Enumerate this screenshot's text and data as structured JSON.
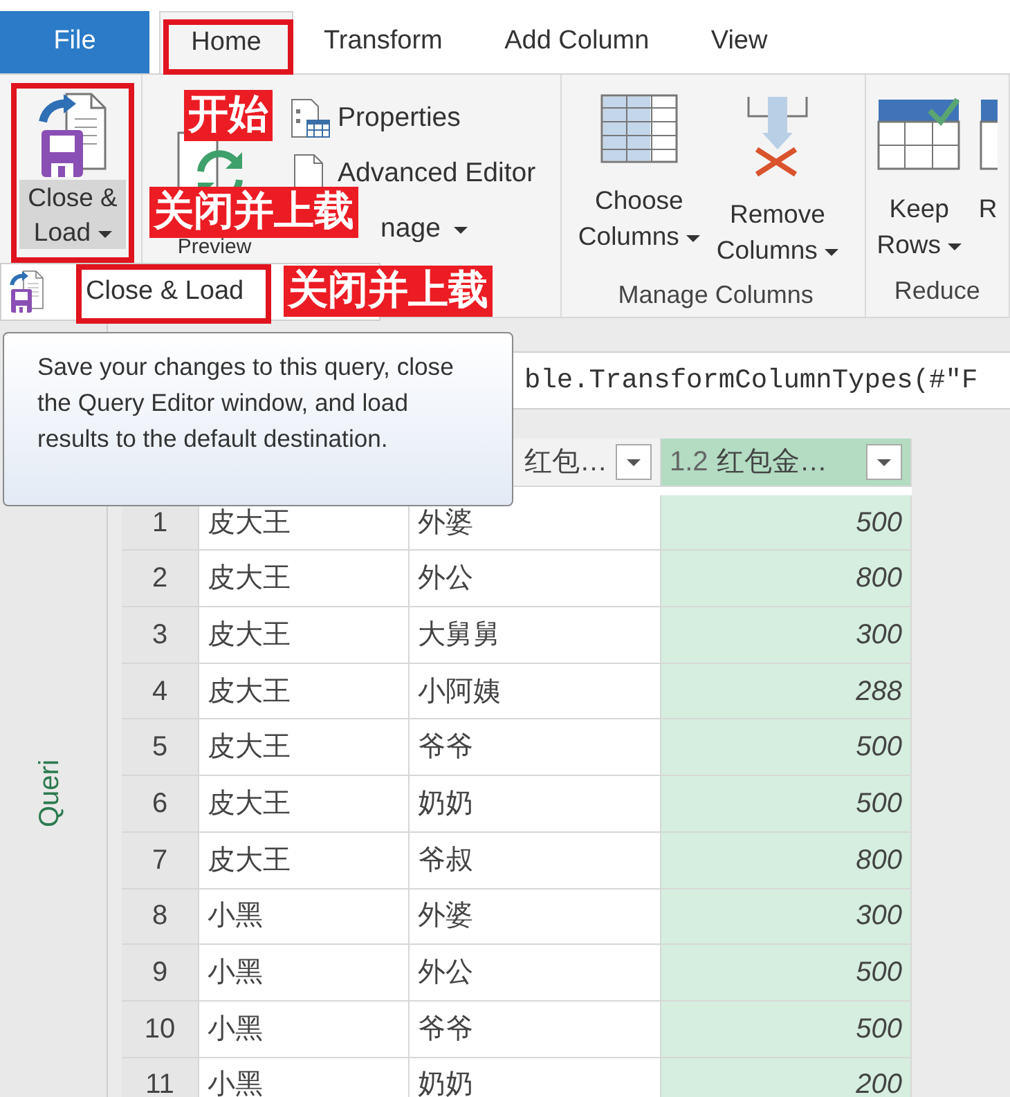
{
  "tabs": [
    {
      "label": "File",
      "kind": "file",
      "selected": false
    },
    {
      "label": "Home",
      "kind": "tab",
      "selected": true
    },
    {
      "label": "Transform",
      "kind": "tab",
      "selected": false
    },
    {
      "label": "Add Column",
      "kind": "tab",
      "selected": false
    },
    {
      "label": "View",
      "kind": "tab",
      "selected": false
    }
  ],
  "ribbon": {
    "close_load": {
      "lines": [
        "Close &",
        "Load"
      ],
      "dropdown": true
    },
    "query": {
      "refresh_label": "Preview",
      "items": [
        {
          "label": "Properties",
          "kind": "properties",
          "dropdown": false
        },
        {
          "label": "Advanced Editor",
          "kind": "editor",
          "dropdown": false
        },
        {
          "label": "nage",
          "kind": "manage",
          "dropdown": true
        }
      ]
    },
    "groups": [
      {
        "label": "Manage Columns",
        "buttons": [
          {
            "lines": [
              "Choose",
              "Columns"
            ],
            "kind": "choose",
            "dropdown": true
          },
          {
            "lines": [
              "Remove",
              "Columns"
            ],
            "kind": "remove",
            "dropdown": true
          }
        ]
      },
      {
        "label": "Reduce",
        "buttons": [
          {
            "lines": [
              "Keep",
              "Rows"
            ],
            "kind": "keep",
            "dropdown": true
          },
          {
            "lines": [
              "R"
            ],
            "kind": "cut",
            "dropdown": false
          }
        ]
      }
    ]
  },
  "menu": {
    "items": [
      {
        "label": "Close & Load"
      }
    ]
  },
  "tooltip": {
    "text": "Save your changes to this query, close the Query Editor window, and load results to the default destination."
  },
  "formula_bar": {
    "text": "ble.TransformColumnTypes(#\"F"
  },
  "queries_pane": {
    "label": "Queri"
  },
  "table": {
    "columns": [
      {
        "header": "红包…",
        "selected": false
      },
      {
        "header": "红包金…",
        "type_label": "1.2",
        "selected": true
      }
    ],
    "rows": [
      {
        "number": "1",
        "cells": [
          "皮大王",
          "外婆",
          "500"
        ]
      },
      {
        "number": "2",
        "cells": [
          "皮大王",
          "外公",
          "800"
        ]
      },
      {
        "number": "3",
        "cells": [
          "皮大王",
          "大舅舅",
          "300"
        ]
      },
      {
        "number": "4",
        "cells": [
          "皮大王",
          "小阿姨",
          "288"
        ]
      },
      {
        "number": "5",
        "cells": [
          "皮大王",
          "爷爷",
          "500"
        ]
      },
      {
        "number": "6",
        "cells": [
          "皮大王",
          "奶奶",
          "500"
        ]
      },
      {
        "number": "7",
        "cells": [
          "皮大王",
          "爷叔",
          "800"
        ]
      },
      {
        "number": "8",
        "cells": [
          "小黑",
          "外婆",
          "300"
        ]
      },
      {
        "number": "9",
        "cells": [
          "小黑",
          "外公",
          "500"
        ]
      },
      {
        "number": "10",
        "cells": [
          "小黑",
          "爷爷",
          "500"
        ]
      },
      {
        "number": "11",
        "cells": [
          "小黑",
          "奶奶",
          "200"
        ]
      }
    ]
  },
  "annotations": [
    "开始",
    "关闭并上载",
    "关闭并上载"
  ]
}
